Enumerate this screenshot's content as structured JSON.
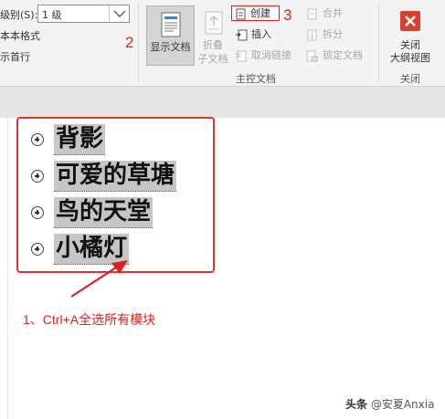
{
  "ribbon": {
    "level_label": "级别(S):",
    "level_value": "1 级",
    "text_format_label": "本本格式",
    "first_line_label": "示首行",
    "show_document": "显示文档",
    "fold_line1": "折叠",
    "fold_line2": "子文档",
    "create": "创建",
    "insert": "插入",
    "unlink": "取消链接",
    "merge": "合并",
    "split": "拆分",
    "lock_document": "锁定文档",
    "master_group": "主控文档",
    "close_line1": "关闭",
    "close_line2": "大纲视图",
    "close_group": "关闭"
  },
  "annotations": {
    "step2": "2",
    "step3": "3",
    "step1": "1、Ctrl+A全选所有模块"
  },
  "outline": {
    "items": [
      {
        "text": "背影"
      },
      {
        "text": "可爱的草塘"
      },
      {
        "text": "鸟的天堂"
      },
      {
        "text": "小橘灯"
      }
    ]
  },
  "watermark": {
    "prefix": "头条",
    "text": "@安夏Anxia"
  },
  "colors": {
    "annotation_red": "#e02121",
    "selection_gray": "#c6c6c6",
    "close_red": "#d5432f"
  }
}
